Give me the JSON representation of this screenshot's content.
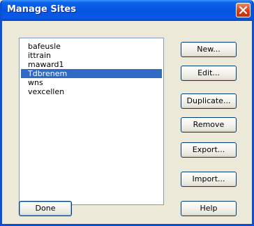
{
  "window": {
    "title": "Manage Sites"
  },
  "sites": {
    "items": [
      {
        "label": "bafeusle",
        "selected": false
      },
      {
        "label": "ittrain",
        "selected": false
      },
      {
        "label": "maward1",
        "selected": false
      },
      {
        "label": "Tdbrenem",
        "selected": true
      },
      {
        "label": "wns",
        "selected": false
      },
      {
        "label": "vexcellen",
        "selected": false
      }
    ]
  },
  "buttons": {
    "new": "New...",
    "edit": "Edit...",
    "duplicate": "Duplicate...",
    "remove": "Remove",
    "export": "Export...",
    "import": "Import...",
    "done": "Done",
    "help": "Help"
  },
  "colors": {
    "titlebar": "#0553e2",
    "selection": "#316ac5",
    "close": "#d1401a"
  },
  "icons": {
    "close": "close-icon"
  }
}
